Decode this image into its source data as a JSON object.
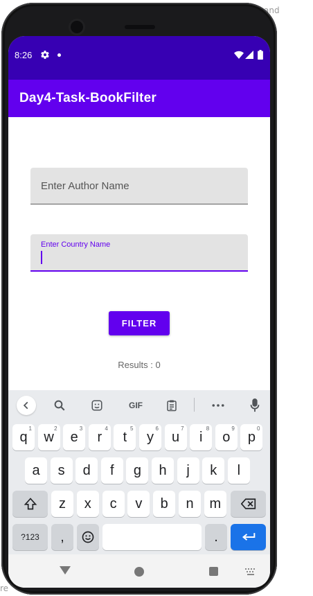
{
  "status": {
    "time": "8:26",
    "settings_icon": "gear-icon",
    "notification_icon": "dot-icon",
    "wifi_icon": "wifi-icon",
    "signal_icon": "signal-icon",
    "battery_icon": "battery-icon"
  },
  "app": {
    "title": "Day4-Task-BookFilter",
    "primary_color": "#6200ee",
    "status_color": "#3700b3"
  },
  "form": {
    "author_placeholder": "Enter  Author Name",
    "country_label": "Enter  Country Name",
    "country_value": "",
    "filter_button": "FILTER",
    "results_text": "Results : 0"
  },
  "keyboard": {
    "toolbar": {
      "back_icon": "chevron-left-icon",
      "search_icon": "search-icon",
      "sticker_icon": "sticker-icon",
      "gif_label": "GIF",
      "clipboard_icon": "clipboard-icon",
      "more_icon": "more-icon",
      "mic_icon": "mic-icon"
    },
    "row1": [
      {
        "k": "q",
        "s": "1"
      },
      {
        "k": "w",
        "s": "2"
      },
      {
        "k": "e",
        "s": "3"
      },
      {
        "k": "r",
        "s": "4"
      },
      {
        "k": "t",
        "s": "5"
      },
      {
        "k": "y",
        "s": "6"
      },
      {
        "k": "u",
        "s": "7"
      },
      {
        "k": "i",
        "s": "8"
      },
      {
        "k": "o",
        "s": "9"
      },
      {
        "k": "p",
        "s": "0"
      }
    ],
    "row2": [
      "a",
      "s",
      "d",
      "f",
      "g",
      "h",
      "j",
      "k",
      "l"
    ],
    "row3": [
      "z",
      "x",
      "c",
      "v",
      "b",
      "n",
      "m"
    ],
    "symbols": "?123",
    "comma": ",",
    "period": "."
  },
  "overlay": {
    "right_edge_text": "and",
    "bottom_left_text": "re"
  }
}
